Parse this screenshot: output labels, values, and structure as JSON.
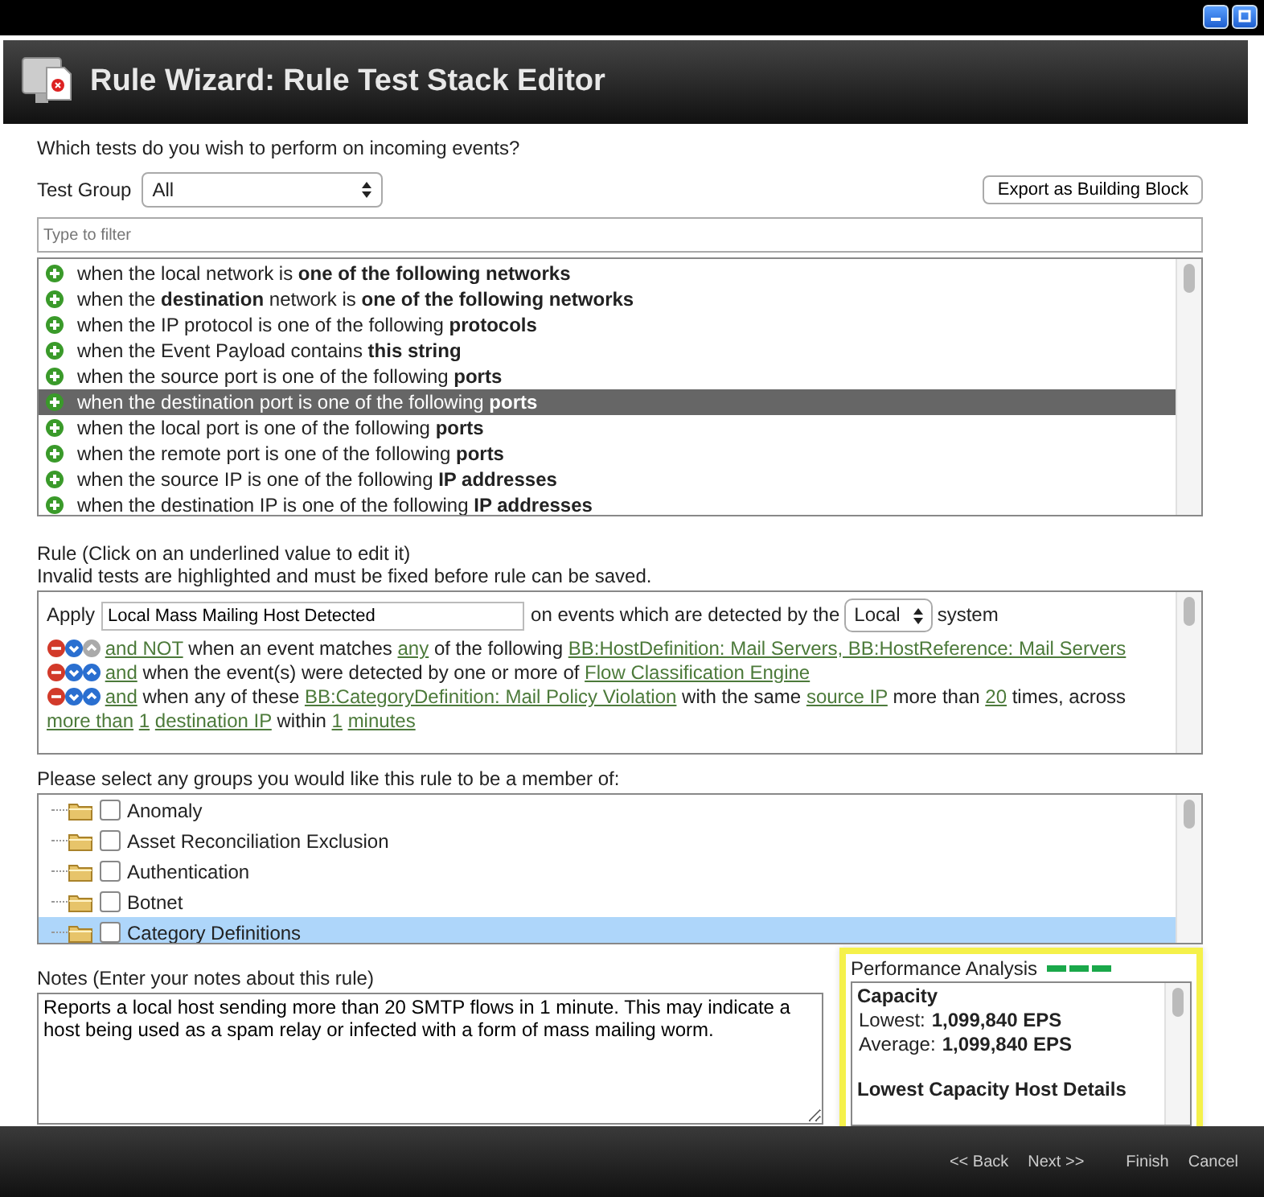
{
  "window": {
    "title": "Rule Wizard: Rule Test Stack Editor"
  },
  "question": "Which tests do you wish to perform on incoming events?",
  "test_group": {
    "label": "Test Group",
    "value": "All"
  },
  "export_button": "Export as Building Block",
  "filter": {
    "placeholder": "Type to filter"
  },
  "tests": [
    {
      "text": "when the local network is **one of the following networks**",
      "selected": false
    },
    {
      "text": "when the **destination** network is **one of the following networks**",
      "selected": false
    },
    {
      "text": "when the IP protocol is one of the following **protocols**",
      "selected": false
    },
    {
      "text": "when the Event Payload contains **this string**",
      "selected": false
    },
    {
      "text": "when the source port is one of the following **ports**",
      "selected": false
    },
    {
      "text": "when the destination port is one of the following **ports**",
      "selected": true
    },
    {
      "text": "when the local port is one of the following **ports**",
      "selected": false
    },
    {
      "text": "when the remote port is one of the following **ports**",
      "selected": false
    },
    {
      "text": "when the source IP is one of the following **IP addresses**",
      "selected": false
    },
    {
      "text": "when the destination IP is one of the following **IP addresses**",
      "selected": false
    }
  ],
  "rule_hint": "Rule (Click on an underlined value to edit it)",
  "rule_warning": "Invalid tests are highlighted and must be fixed before rule can be saved.",
  "rule": {
    "apply_label": "Apply",
    "name": "Local Mass Mailing Host Detected",
    "events_label": "on events which are detected by the",
    "system": "Local",
    "system_label": "system",
    "lines": [
      {
        "up_enabled": false,
        "parts": [
          {
            "kind": "link",
            "text": "and NOT"
          },
          {
            "kind": "text",
            "text": "when an event matches"
          },
          {
            "kind": "link",
            "text": "any"
          },
          {
            "kind": "text",
            "text": "of the following"
          },
          {
            "kind": "link",
            "text": "BB:HostDefinition: Mail Servers, BB:HostReference: Mail Servers"
          }
        ]
      },
      {
        "up_enabled": true,
        "parts": [
          {
            "kind": "link",
            "text": "and"
          },
          {
            "kind": "text",
            "text": "when the event(s) were detected by one or more of"
          },
          {
            "kind": "link",
            "text": "Flow Classification Engine"
          }
        ]
      },
      {
        "up_enabled": true,
        "parts": [
          {
            "kind": "link",
            "text": "and"
          },
          {
            "kind": "text",
            "text": "when any of these"
          },
          {
            "kind": "link",
            "text": "BB:CategoryDefinition: Mail Policy Violation"
          },
          {
            "kind": "text",
            "text": "with the same"
          },
          {
            "kind": "link",
            "text": "source IP"
          },
          {
            "kind": "text",
            "text": "more than"
          },
          {
            "kind": "link",
            "text": "20"
          },
          {
            "kind": "text",
            "text": "times, across"
          },
          {
            "kind": "link",
            "text": "more than"
          },
          {
            "kind": "link",
            "text": "1"
          },
          {
            "kind": "link",
            "text": "destination IP"
          },
          {
            "kind": "text",
            "text": "within"
          },
          {
            "kind": "link",
            "text": "1"
          },
          {
            "kind": "link",
            "text": "minutes"
          }
        ]
      }
    ]
  },
  "groups_prompt": "Please select any groups you would like this rule to be a member of:",
  "groups": [
    {
      "name": "Anomaly",
      "checked": false,
      "selected": false
    },
    {
      "name": "Asset Reconciliation Exclusion",
      "checked": false,
      "selected": false
    },
    {
      "name": "Authentication",
      "checked": false,
      "selected": false
    },
    {
      "name": "Botnet",
      "checked": false,
      "selected": false
    },
    {
      "name": "Category Definitions",
      "checked": false,
      "selected": true
    }
  ],
  "notes": {
    "label": "Notes (Enter your notes about this rule)",
    "value": "Reports a local host sending more than 20 SMTP flows in 1 minute. This may indicate a host being used as a spam relay or infected with a form of mass mailing worm."
  },
  "performance": {
    "title": "Performance Analysis",
    "heading": "Capacity",
    "rows": [
      {
        "label": "Lowest:",
        "value": "1,099,840 EPS"
      },
      {
        "label": "Average:",
        "value": "1,099,840 EPS"
      }
    ],
    "subheading": "Lowest Capacity Host Details"
  },
  "footer_buttons": [
    "<< Back",
    "Next >>",
    "Finish",
    "Cancel"
  ]
}
